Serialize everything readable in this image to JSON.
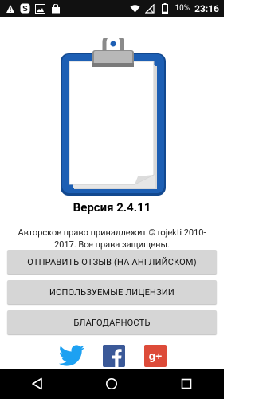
{
  "status_bar": {
    "left_icons": [
      "warning-icon",
      "sync-icon",
      "image-icon",
      "shopping-bag-icon"
    ],
    "right_icons": [
      "wifi-icon",
      "no-sim-icon",
      "battery-icon"
    ],
    "battery_text": "10%",
    "time": "23:16"
  },
  "about": {
    "version": "Версия 2.4.11",
    "copyright": "Авторское право принадлежит © rojekti 2010-2017. Все права защищены."
  },
  "buttons": {
    "feedback": "ОТПРАВИТЬ ОТЗЫВ (НА АНГЛИЙСКОМ)",
    "licenses": "ИСПОЛЬЗУЕМЫЕ ЛИЦЕНЗИИ",
    "thanks": "БЛАГОДАРНОСТЬ"
  },
  "social": {
    "twitter": "twitter-icon",
    "facebook": "facebook-icon",
    "gplus": "google-plus-icon",
    "gplus_label": "g+"
  },
  "nav_bar": {
    "back": "back-icon",
    "home": "home-icon",
    "recents": "recents-icon"
  },
  "colors": {
    "clipboard_blue": "#1d5fb4",
    "twitter_blue": "#1da1f2",
    "facebook_blue": "#3b5998",
    "gplus_red": "#dd4b39",
    "button_gray": "#d6d6d6"
  }
}
